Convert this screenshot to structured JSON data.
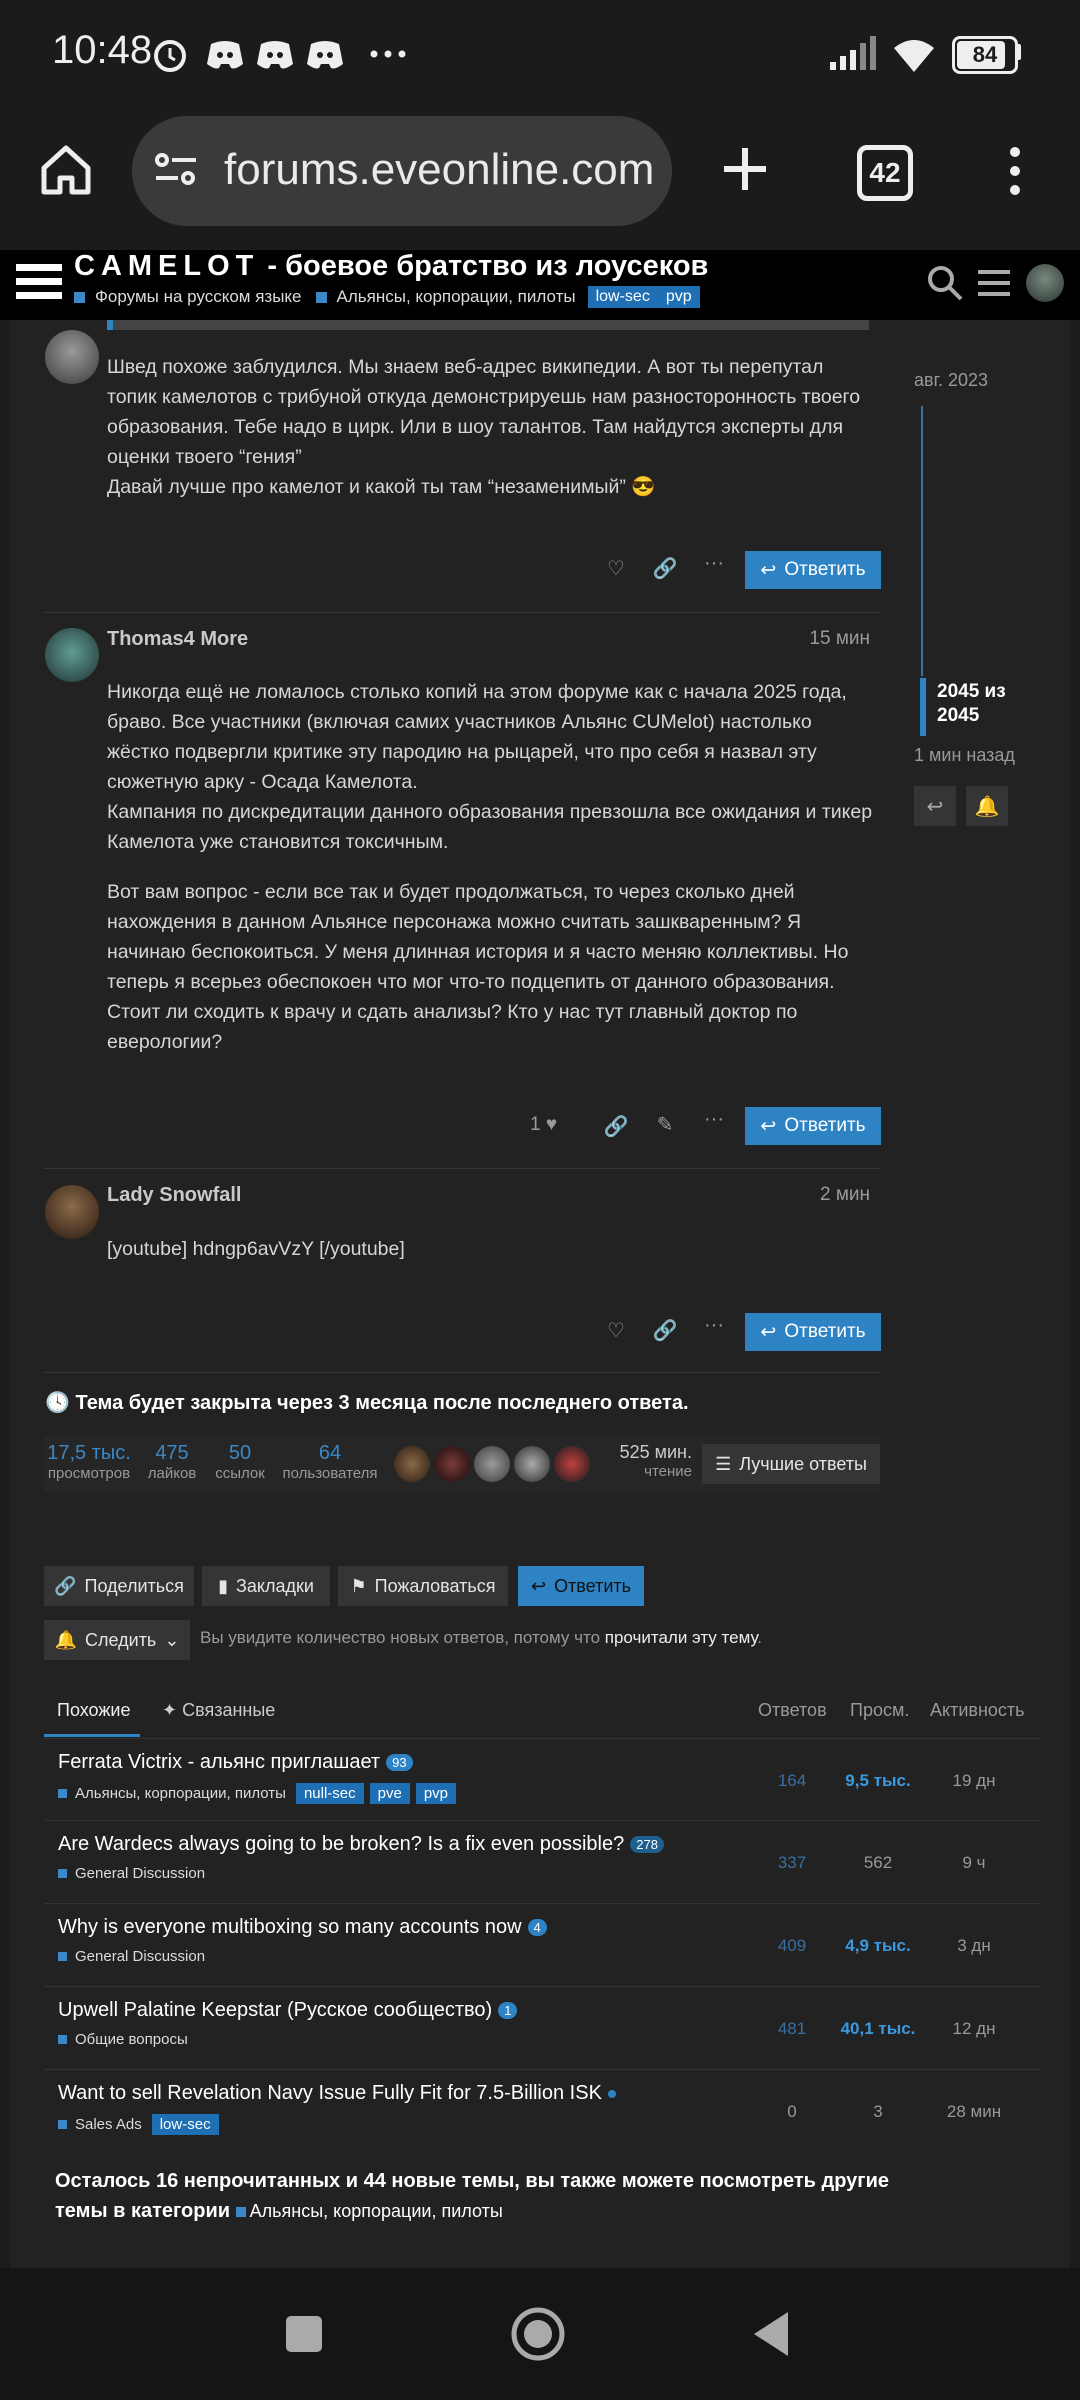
{
  "status_bar": {
    "time": "10:48",
    "icons": [
      "alarm-icon",
      "discord-icon",
      "discord-icon",
      "discord-icon",
      "more-icon",
      "signal-icon",
      "wifi-icon",
      "battery-icon"
    ],
    "battery": "84"
  },
  "browser": {
    "url": "forums.eveonline.com",
    "tab_count": "42"
  },
  "site_header": {
    "title_spaced": "CAMELOT",
    "title_rest": " - боевое братство из лоусеков",
    "breadcrumb_category": "Форумы на русском языке",
    "breadcrumb_subcategory": "Альянсы, корпорации, пилоты",
    "tags": [
      "low-sec",
      "pvp"
    ]
  },
  "posts": [
    {
      "author": "",
      "paragraphs": [
        "Швед похоже заблудился. Мы знаем веб-адрес википедии. А вот ты перепутал топик камелотов с трибуной откуда демонстрируешь нам разносторонность твоего образования. Тебе надо в цирк. Или в шоу талантов. Там найдутся эксперты для оценки твоего “гения”",
        "Давай лучше про камелот и какой ты там “незаменимый” 😎"
      ],
      "reply_label": "Ответить"
    },
    {
      "author": "Thomas4 More",
      "time": "15 мин",
      "paragraphs": [
        "Никогда ещё не ломалось столько копий на этом форуме как с начала 2025 года, браво. Все участники (включая самих участников Альянс CUMelot) настолько жёстко подвергли критике эту пародию на рыцарей, что про себя я назвал эту сюжетную арку - Осада Камелота.",
        "Кампания по дискредитации данного образования превзошла все ожидания и тикер Камелота уже становится токсичным.",
        "Вот вам вопрос - если все так и будет продолжаться, то через сколько дней нахождения в данном Альянсе персонажа можно считать зашкваренным? Я начинаю беспокоиться. У меня длинная история и я часто меняю коллективы. Но теперь я всерьез обеспокоен что мог что-то подцепить от данного образования. Стоит ли сходить к врачу и сдать анализы? Кто у нас тут главный доктор по еверологии?"
      ],
      "likes": "1",
      "reply_label": "Ответить"
    },
    {
      "author": "Lady Snowfall",
      "time": "2 мин",
      "paragraphs": [
        "[youtube] hdngp6avVzY [/youtube]"
      ],
      "reply_label": "Ответить"
    }
  ],
  "timeline": {
    "start_date": "авг. 2023",
    "position": "2045 из 2045",
    "position_line1": "2045 из",
    "position_line2": "2045",
    "progress": 1.0,
    "last_activity": "1 мин назад"
  },
  "topic_footer": {
    "close_notice": "Тема будет закрыта через 3 месяца после последнего ответа.",
    "stats": [
      {
        "value": "17,5 тыс.",
        "label": "просмотров"
      },
      {
        "value": "475",
        "label": "лайков"
      },
      {
        "value": "50",
        "label": "ссылок"
      },
      {
        "value": "64",
        "label": "пользователя"
      }
    ],
    "read_time_value": "525 мин.",
    "read_time_label": "чтение",
    "best_answers": "Лучшие ответы",
    "share": "Поделиться",
    "bookmarks": "Закладки",
    "flag": "Пожаловаться",
    "reply": "Ответить",
    "follow": "Следить",
    "follow_note_prefix": "Вы увидите количество новых ответов, потому что ",
    "follow_note_link": "прочитали эту тему",
    "follow_note_suffix": "."
  },
  "suggested": {
    "tab_similar": "Похожие",
    "tab_related": "Связанные",
    "col_replies": "Ответов",
    "col_views": "Просм.",
    "col_activity": "Активность",
    "topics": [
      {
        "title": "Ferrata Victrix - альянс приглашает",
        "badge": "93",
        "category": "Альянсы, корпорации, пилоты",
        "tags": [
          "null-sec",
          "pve",
          "pvp"
        ],
        "replies": "164",
        "views": "9,5 тыс.",
        "activity": "19 дн"
      },
      {
        "title": "Are Wardecs always going to be broken? Is a fix even possible?",
        "badge": "278",
        "category": "General Discussion",
        "tags": [],
        "replies": "337",
        "views": "562",
        "activity": "9 ч"
      },
      {
        "title": "Why is everyone multiboxing so many accounts now",
        "badge": "4",
        "category": "General Discussion",
        "tags": [],
        "replies": "409",
        "views": "4,9 тыс.",
        "activity": "3 дн"
      },
      {
        "title": "Upwell Palatine Keepstar (Русское сообщество)",
        "badge": "1",
        "category": "Общие вопросы",
        "tags": [],
        "replies": "481",
        "views": "40,1 тыс.",
        "activity": "12 дн"
      },
      {
        "title": "Want to sell Revelation Navy Issue Fully Fit for 7.5-Billion ISK",
        "badge": "",
        "category": "Sales Ads",
        "tags": [
          "low-sec"
        ],
        "replies": "0",
        "views": "3",
        "activity": "28 мин"
      }
    ],
    "remaining_text": "Осталось 16 непрочитанных и 44 новые темы, вы также можете посмотреть другие темы в категории",
    "remaining_category": "Альянсы, корпорации, пилоты"
  },
  "colors": {
    "accent": "#2d83c4",
    "background": "#222222",
    "header": "#000000"
  }
}
